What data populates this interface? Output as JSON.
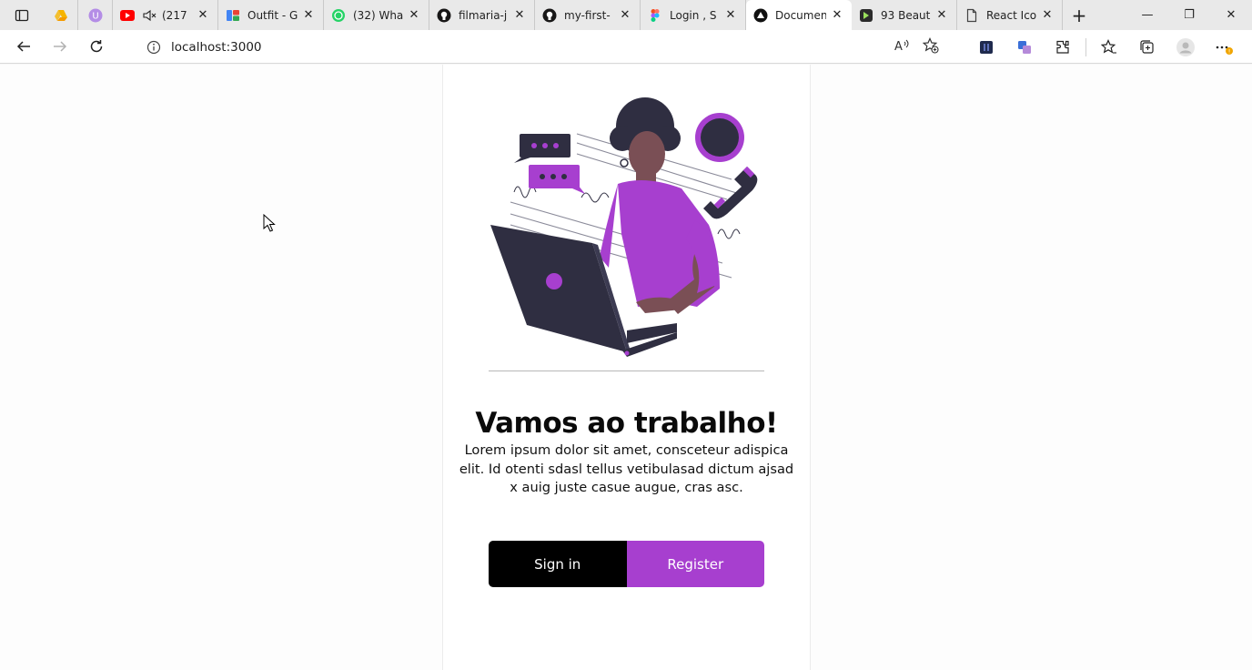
{
  "browser": {
    "tabs": [
      {
        "title": "(217",
        "favicon": "youtube-icon",
        "color": "#ff0000",
        "muted": true
      },
      {
        "title": "Outfit - G",
        "favicon": "google-fonts-icon",
        "color": "#4285f4"
      },
      {
        "title": "(32) Wha",
        "favicon": "whatsapp-icon",
        "color": "#25d366"
      },
      {
        "title": "filmaria-j",
        "favicon": "github-icon",
        "color": "#181717"
      },
      {
        "title": "my-first-",
        "favicon": "github-icon",
        "color": "#181717"
      },
      {
        "title": "Login , S",
        "favicon": "figma-icon",
        "color": "#f24e1e"
      },
      {
        "title": "Documen",
        "favicon": "react-app-icon",
        "color": "#111111",
        "active": true
      },
      {
        "title": "93 Beaut",
        "favicon": "dribbble-like-icon",
        "color": "#2b2b2b"
      },
      {
        "title": "React Ico",
        "favicon": "document-icon",
        "color": "#555555"
      }
    ],
    "address": "localhost:3000"
  },
  "colors": {
    "accent": "#a73fcf",
    "dark": "#2f2e41",
    "black": "#000000"
  },
  "page": {
    "headline": "Vamos ao trabalho!",
    "description": "Lorem ipsum dolor sit amet, consceteur adispica elit. Id otenti sdasl tellus vetibulasad dictum ajsad x auig juste casue augue, cras asc.",
    "signin_label": "Sign in",
    "register_label": "Register"
  }
}
